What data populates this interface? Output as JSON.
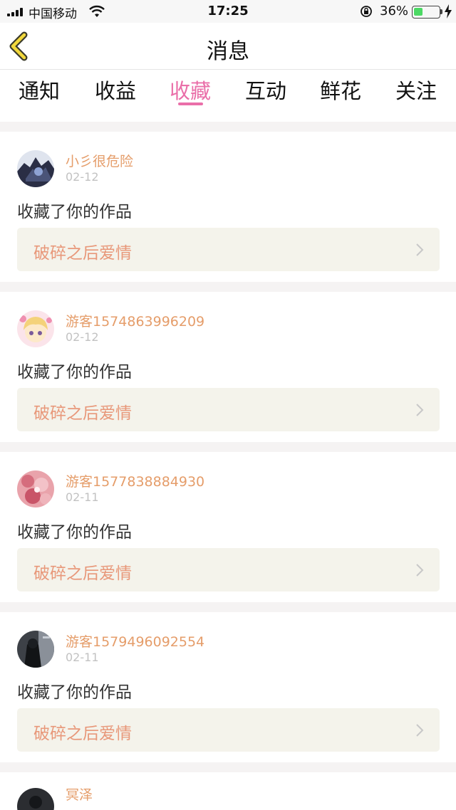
{
  "status_bar": {
    "carrier": "中国移动",
    "time": "17:25",
    "battery_percent_text": "36%",
    "battery_level": 0.36
  },
  "header": {
    "title": "消息"
  },
  "tabs": [
    {
      "label": "通知",
      "active": false
    },
    {
      "label": "收益",
      "active": false
    },
    {
      "label": "收藏",
      "active": true
    },
    {
      "label": "互动",
      "active": false
    },
    {
      "label": "鲜花",
      "active": false
    },
    {
      "label": "关注",
      "active": false
    }
  ],
  "colors": {
    "accent_pink": "#ea6fa9",
    "username_orange": "#e59d6a",
    "work_title": "#e8987a",
    "work_box_bg": "#f4f3eb"
  },
  "messages": [
    {
      "username": "小彡很危险",
      "date": "02-12",
      "action": "收藏了你的作品",
      "work": "破碎之后爱情"
    },
    {
      "username": "游客1574863996209",
      "date": "02-12",
      "action": "收藏了你的作品",
      "work": "破碎之后爱情"
    },
    {
      "username": "游客1577838884930",
      "date": "02-11",
      "action": "收藏了你的作品",
      "work": "破碎之后爱情"
    },
    {
      "username": "游客1579496092554",
      "date": "02-11",
      "action": "收藏了你的作品",
      "work": "破碎之后爱情"
    },
    {
      "username": "冥泽"
    }
  ]
}
